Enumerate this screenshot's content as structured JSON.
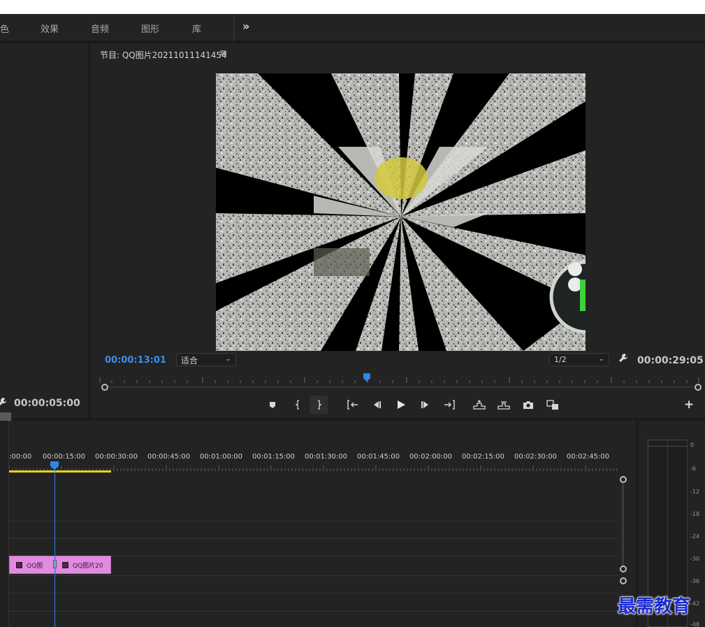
{
  "workspace_tabs": [
    {
      "label": "色"
    },
    {
      "label": "效果"
    },
    {
      "label": "音频"
    },
    {
      "label": "图形"
    },
    {
      "label": "库"
    }
  ],
  "more_tabs_label": "»",
  "source_panel": {
    "timecode": "00:00:05:00",
    "add_button": "+"
  },
  "program_monitor": {
    "title": "节目: QQ图片20211011141454",
    "menu_icon": "≡",
    "current_timecode": "00:00:13:01",
    "current_timecode_color": "#3d8fe9",
    "zoom_select": "适合",
    "resolution_select": "1/2",
    "duration": "00:00:29:05",
    "add_button": "+",
    "transport_icons": [
      "add-marker-icon",
      "mark-in-icon",
      "mark-out-icon",
      "go-to-in-icon",
      "step-back-icon",
      "play-icon",
      "step-forward-icon",
      "go-to-out-icon",
      "lift-icon",
      "extract-icon",
      "export-frame-icon",
      "comparison-view-icon"
    ]
  },
  "timeline": {
    "ruler_labels": [
      ":00:00",
      "00:00:15:00",
      "00:00:30:00",
      "00:00:45:00",
      "00:01:00:00",
      "00:01:15:00",
      "00:01:30:00",
      "00:01:45:00",
      "00:02:00:00",
      "00:02:15:00",
      "00:02:30:00",
      "00:02:45:00"
    ],
    "work_area_color": "#e5d515",
    "clips": [
      {
        "label": "QQ图"
      },
      {
        "label": "QQ图片20"
      }
    ],
    "clip_color": "#e08be0"
  },
  "audio_meter": {
    "scale": [
      "0",
      "-6",
      "-12",
      "-18",
      "-24",
      "-30",
      "-36",
      "-42",
      "-48"
    ]
  },
  "watermark": "最需教育"
}
